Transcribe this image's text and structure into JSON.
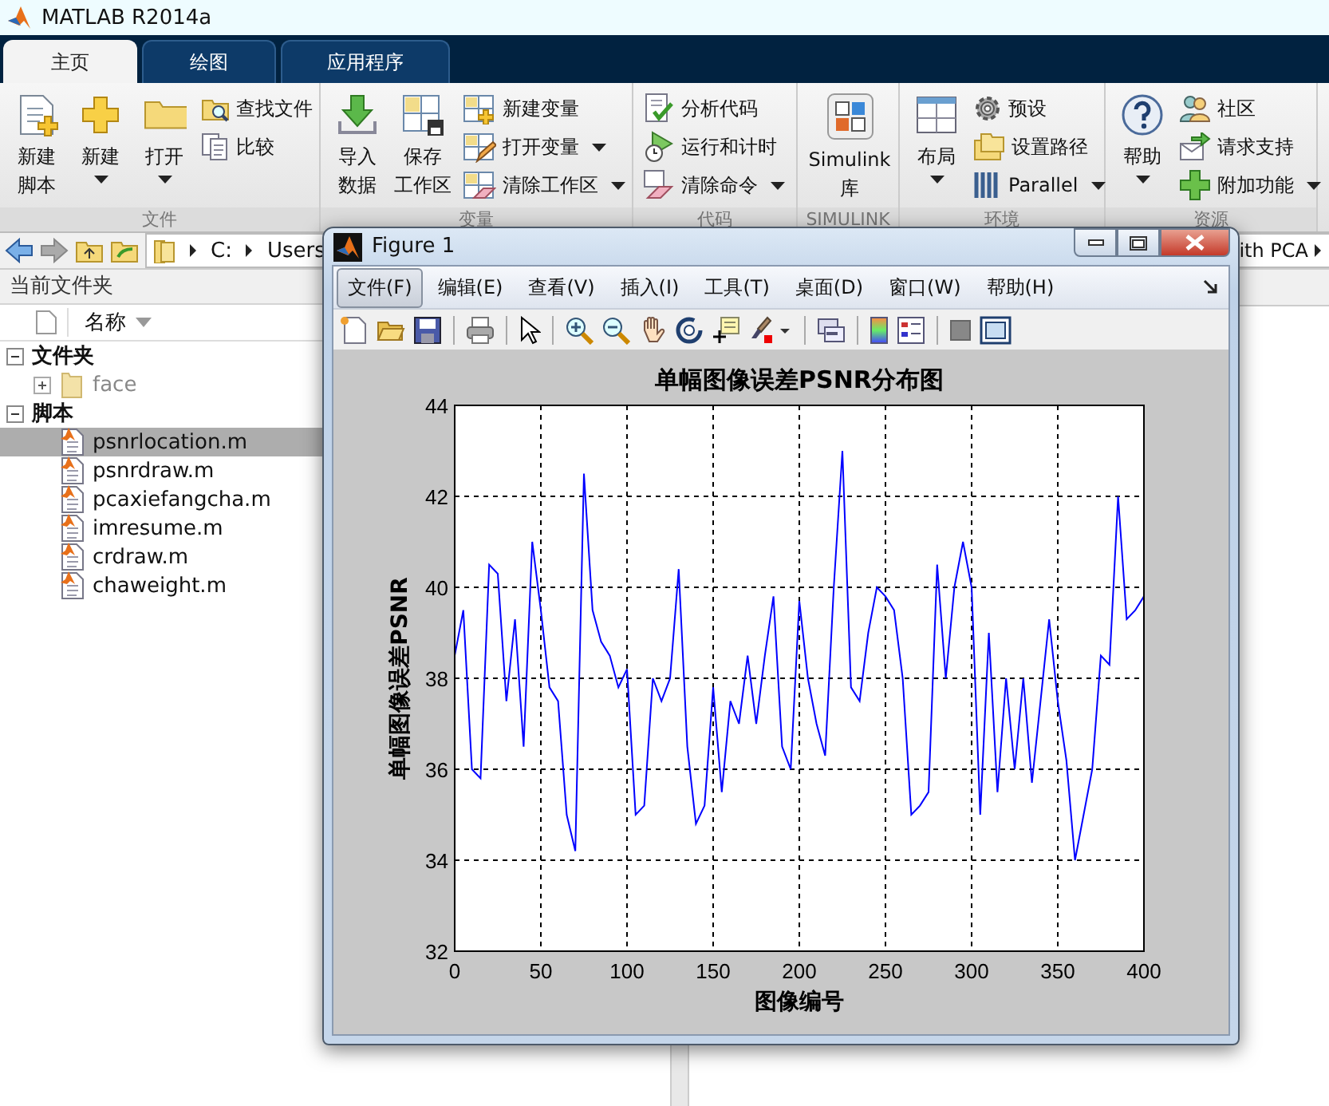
{
  "window": {
    "title": "MATLAB R2014a"
  },
  "ribbon": {
    "tabs": [
      {
        "label": "主页",
        "selected": true
      },
      {
        "label": "绘图",
        "selected": false
      },
      {
        "label": "应用程序",
        "selected": false
      }
    ],
    "groups": [
      {
        "label": "文件",
        "large": [
          {
            "lines": [
              "新建",
              "脚本"
            ],
            "dropdown": false
          },
          {
            "lines": [
              "新建"
            ],
            "dropdown": true
          },
          {
            "lines": [
              "打开"
            ],
            "dropdown": true
          }
        ],
        "small": [
          {
            "label": "查找文件",
            "dropdown": false
          },
          {
            "label": "比较",
            "dropdown": false
          }
        ]
      },
      {
        "label": "变量",
        "large": [
          {
            "lines": [
              "导入",
              "数据"
            ],
            "dropdown": false
          },
          {
            "lines": [
              "保存",
              "工作区"
            ],
            "dropdown": false
          }
        ],
        "small": [
          {
            "label": "新建变量",
            "dropdown": false
          },
          {
            "label": "打开变量",
            "dropdown": true
          },
          {
            "label": "清除工作区",
            "dropdown": true
          }
        ]
      },
      {
        "label": "代码",
        "small": [
          {
            "label": "分析代码",
            "dropdown": false
          },
          {
            "label": "运行和计时",
            "dropdown": false
          },
          {
            "label": "清除命令",
            "dropdown": true
          }
        ]
      },
      {
        "label": "SIMULINK",
        "large": [
          {
            "lines": [
              "Simulink",
              "库"
            ],
            "dropdown": false
          }
        ]
      },
      {
        "label": "环境",
        "large": [
          {
            "lines": [
              "布局"
            ],
            "dropdown": true
          }
        ],
        "small": [
          {
            "label": "预设",
            "dropdown": false
          },
          {
            "label": "设置路径",
            "dropdown": false
          },
          {
            "label": "Parallel",
            "dropdown": true
          }
        ]
      },
      {
        "label": "资源",
        "large": [
          {
            "lines": [
              "帮助"
            ],
            "dropdown": true
          }
        ],
        "small": [
          {
            "label": "社区",
            "dropdown": false
          },
          {
            "label": "请求支持",
            "dropdown": false
          },
          {
            "label": "附加功能",
            "dropdown": true
          }
        ]
      }
    ]
  },
  "address_bar": {
    "path_start": [
      "C:",
      "Users"
    ],
    "path_end": "ith PCA"
  },
  "file_browser": {
    "title": "当前文件夹",
    "column": "名称",
    "tree": [
      {
        "label": "文件夹",
        "expanded": true,
        "children": [
          {
            "label": "face",
            "kind": "folder",
            "expanded": false,
            "dimmed": true,
            "selected": false
          }
        ]
      },
      {
        "label": "脚本",
        "expanded": true,
        "children": [
          {
            "label": "psnrlocation.m",
            "kind": "file",
            "dimmed": false,
            "selected": true
          },
          {
            "label": "psnrdraw.m",
            "kind": "file",
            "dimmed": false,
            "selected": false
          },
          {
            "label": "pcaxiefangcha.m",
            "kind": "file",
            "dimmed": false,
            "selected": false
          },
          {
            "label": "imresume.m",
            "kind": "file",
            "dimmed": false,
            "selected": false
          },
          {
            "label": "crdraw.m",
            "kind": "file",
            "dimmed": false,
            "selected": false
          },
          {
            "label": "chaweight.m",
            "kind": "file",
            "dimmed": false,
            "selected": false
          }
        ]
      }
    ]
  },
  "figure": {
    "title": "Figure 1",
    "menu": [
      {
        "label": "文件(F)",
        "selected": true
      },
      {
        "label": "编辑(E)",
        "selected": false
      },
      {
        "label": "查看(V)",
        "selected": false
      },
      {
        "label": "插入(I)",
        "selected": false
      },
      {
        "label": "工具(T)",
        "selected": false
      },
      {
        "label": "桌面(D)",
        "selected": false
      },
      {
        "label": "窗口(W)",
        "selected": false
      },
      {
        "label": "帮助(H)",
        "selected": false
      }
    ],
    "chart_data": {
      "type": "line",
      "title": "单幅图像误差PSNR分布图",
      "xlabel": "图像编号",
      "ylabel": "单幅图像误差PSNR",
      "x": [
        0,
        5,
        10,
        15,
        20,
        25,
        30,
        35,
        40,
        45,
        50,
        55,
        60,
        65,
        70,
        75,
        80,
        85,
        90,
        95,
        100,
        105,
        110,
        115,
        120,
        125,
        130,
        135,
        140,
        145,
        150,
        155,
        160,
        165,
        170,
        175,
        180,
        185,
        190,
        195,
        200,
        205,
        210,
        215,
        220,
        225,
        230,
        235,
        240,
        245,
        250,
        255,
        260,
        265,
        270,
        275,
        280,
        285,
        290,
        295,
        300,
        305,
        310,
        315,
        320,
        325,
        330,
        335,
        340,
        345,
        350,
        355,
        360,
        365,
        370,
        375,
        380,
        385,
        390,
        395,
        400
      ],
      "series": [
        {
          "color": "#0000ff",
          "values": [
            38.5,
            39.5,
            36,
            35.8,
            40.5,
            40.3,
            37.5,
            39.3,
            36.5,
            41,
            39.5,
            37.8,
            37.5,
            35,
            34.2,
            42.5,
            39.5,
            38.8,
            38.5,
            37.8,
            38.2,
            35,
            35.2,
            38,
            37.5,
            38,
            40.4,
            36.5,
            34.8,
            35.2,
            37.8,
            35.5,
            37.5,
            37,
            38.5,
            37,
            38.5,
            39.8,
            36.5,
            36,
            39.7,
            38,
            37,
            36.3,
            40,
            43,
            37.8,
            37.5,
            39,
            40,
            39.8,
            39.5,
            38,
            35,
            35.2,
            35.5,
            40.5,
            38,
            40,
            41,
            40,
            35,
            39,
            35.5,
            38,
            36,
            38,
            35.7,
            37.5,
            39.3,
            37.5,
            36.2,
            34,
            35,
            36,
            38.5,
            38.3,
            42,
            39.3,
            39.5,
            39.8
          ]
        }
      ],
      "grid": true,
      "xlim": [
        0,
        400
      ],
      "ylim": [
        32,
        44
      ],
      "xticks": [
        0,
        50,
        100,
        150,
        200,
        250,
        300,
        350,
        400
      ],
      "yticks": [
        32,
        34,
        36,
        38,
        40,
        42,
        44
      ]
    }
  }
}
